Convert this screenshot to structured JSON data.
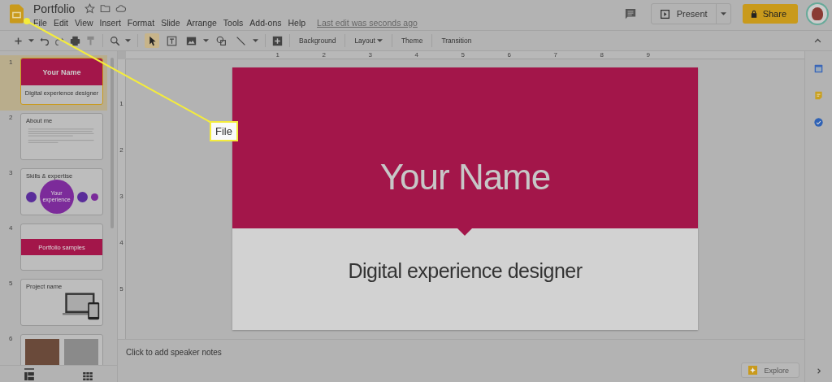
{
  "document": {
    "title": "Portfolio",
    "last_edit": "Last edit was seconds ago"
  },
  "menu": [
    "File",
    "Edit",
    "View",
    "Insert",
    "Format",
    "Slide",
    "Arrange",
    "Tools",
    "Add-ons",
    "Help"
  ],
  "header": {
    "present": "Present",
    "share": "Share"
  },
  "tools": [
    {
      "kind": "select",
      "selected": true
    },
    {
      "kind": "textbox",
      "selected": false
    },
    {
      "kind": "image",
      "selected": false
    },
    {
      "kind": "shape",
      "selected": false
    },
    {
      "kind": "line",
      "selected": false
    }
  ],
  "toolbar_buttons": [
    {
      "label": "Background",
      "dropdown": false
    },
    {
      "label": "Layout",
      "dropdown": true
    },
    {
      "label": "Theme",
      "dropdown": false
    },
    {
      "label": "Transition",
      "dropdown": false
    }
  ],
  "ruler": {
    "horizontal": [
      "1",
      "2",
      "3",
      "4",
      "5",
      "6",
      "7",
      "8",
      "9"
    ],
    "vertical": [
      "1",
      "2",
      "3",
      "4",
      "5"
    ]
  },
  "filmstrip": {
    "slides": [
      {
        "number": "1",
        "selected": true,
        "kind": "title",
        "title": "Your Name",
        "subtitle": "Digital experience designer"
      },
      {
        "number": "2",
        "selected": false,
        "kind": "text",
        "title": "About me"
      },
      {
        "number": "3",
        "selected": false,
        "kind": "circles",
        "title": "Skills & expertise",
        "center": "Your experience"
      },
      {
        "number": "4",
        "selected": false,
        "kind": "band",
        "title": "Portfolio samples"
      },
      {
        "number": "5",
        "selected": false,
        "kind": "devices",
        "title": "Project name"
      },
      {
        "number": "6",
        "selected": false,
        "kind": "photos"
      }
    ],
    "view_modes": [
      {
        "kind": "list",
        "selected": true
      },
      {
        "kind": "grid",
        "selected": false
      }
    ]
  },
  "slide": {
    "title": "Your Name",
    "subtitle": "Digital experience designer"
  },
  "speaker_notes": {
    "placeholder": "Click to add speaker notes"
  },
  "explore": "Explore",
  "callout": {
    "label": "File"
  }
}
